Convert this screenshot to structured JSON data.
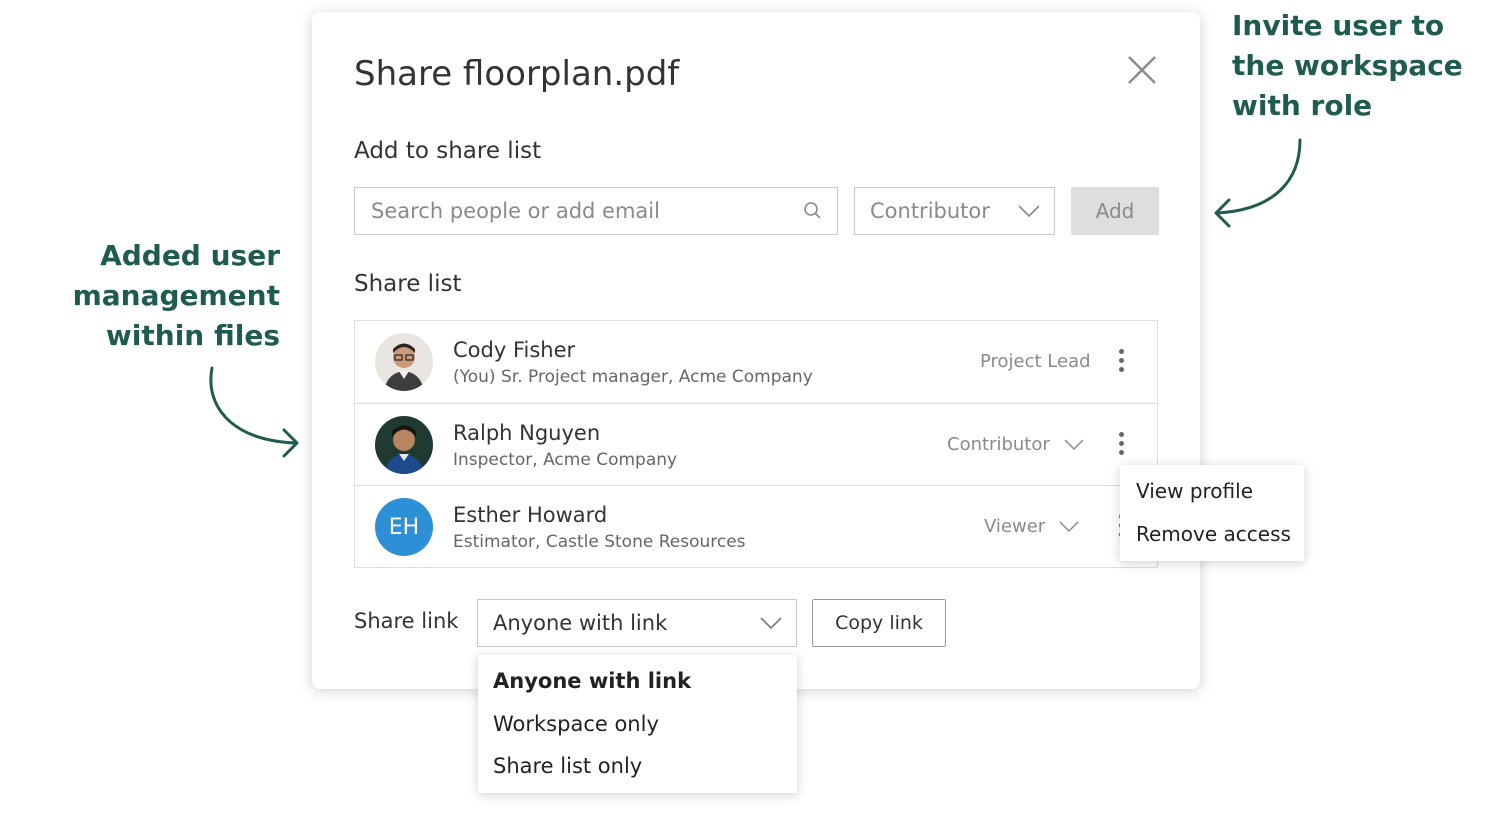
{
  "annotations": {
    "left": [
      "Added user",
      "management",
      "within files"
    ],
    "right": [
      "Invite user to",
      "the workspace",
      "with role"
    ]
  },
  "dialog": {
    "title": "Share floorplan.pdf",
    "add_section_label": "Add to share list",
    "search": {
      "placeholder": "Search people or add email",
      "value": ""
    },
    "role_select_value": "Contributor",
    "add_button_label": "Add",
    "share_list_label": "Share list",
    "share_list": [
      {
        "name": "Cody Fisher",
        "subtitle": "(You) Sr. Project manager, Acme Company",
        "role": "Project Lead",
        "role_editable": false,
        "avatar": "photo"
      },
      {
        "name": "Ralph Nguyen",
        "subtitle": "Inspector, Acme Company",
        "role": "Contributor",
        "role_editable": true,
        "avatar": "photo"
      },
      {
        "name": "Esther Howard",
        "subtitle": "Estimator, Castle Stone Resources",
        "role": "Viewer",
        "role_editable": true,
        "avatar_initials": "EH",
        "avatar_color": "#2d8fd5"
      }
    ],
    "share_link_label": "Share link",
    "share_link_value": "Anyone with link",
    "copy_link_label": "Copy link"
  },
  "context_menu": {
    "items": [
      "View profile",
      "Remove access"
    ]
  },
  "link_dropdown": {
    "items": [
      "Anyone with link",
      "Workspace only",
      "Share list only"
    ],
    "selected": "Anyone with link"
  },
  "colors": {
    "annotation": "#1f5c4f",
    "avatar_blue": "#2d8fd5",
    "add_button_bg": "#dedede"
  }
}
